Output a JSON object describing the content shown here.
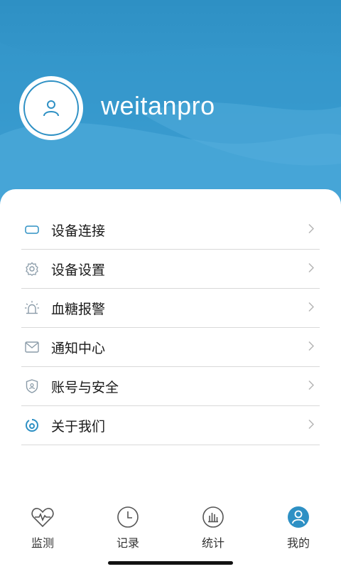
{
  "profile": {
    "username": "weitanpro"
  },
  "menu": {
    "items": [
      {
        "label": "设备连接",
        "icon": "device-icon"
      },
      {
        "label": "设备设置",
        "icon": "gear-icon"
      },
      {
        "label": "血糖报警",
        "icon": "alarm-icon"
      },
      {
        "label": "通知中心",
        "icon": "mail-icon"
      },
      {
        "label": "账号与安全",
        "icon": "shield-icon"
      },
      {
        "label": "关于我们",
        "icon": "logo-icon"
      }
    ]
  },
  "tabbar": {
    "tabs": [
      {
        "label": "监测",
        "icon": "heart-monitor-icon",
        "active": false
      },
      {
        "label": "记录",
        "icon": "clock-icon",
        "active": false
      },
      {
        "label": "统计",
        "icon": "bar-chart-icon",
        "active": false
      },
      {
        "label": "我的",
        "icon": "user-icon",
        "active": true
      }
    ]
  },
  "colors": {
    "accent": "#2e90c4",
    "icon_gray": "#8a9ba8",
    "divider": "#d9d9d9"
  }
}
